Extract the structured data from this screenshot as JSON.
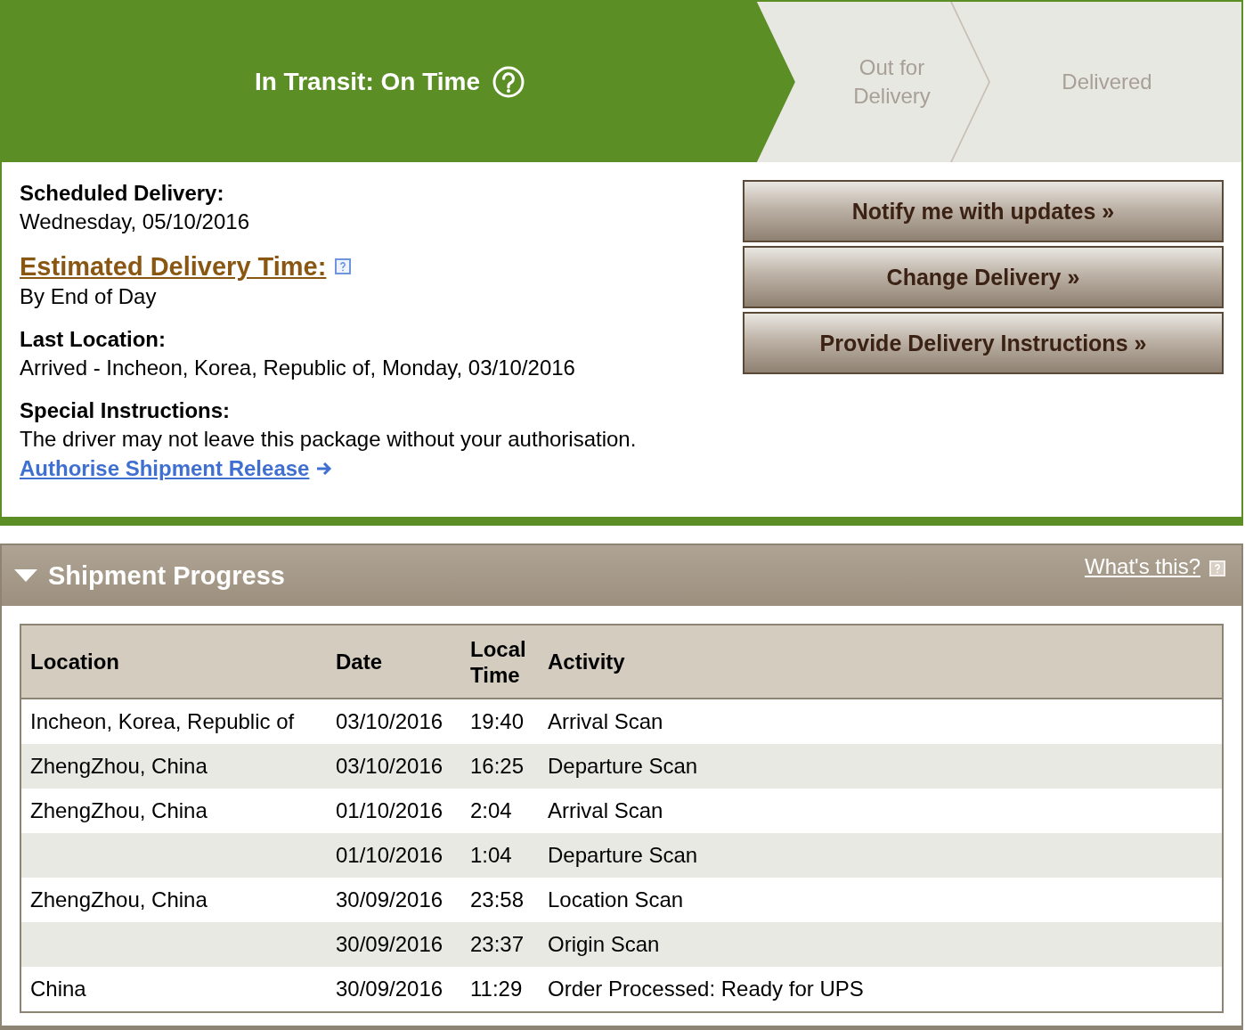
{
  "status_tracker": {
    "steps": [
      {
        "label": "In Transit: On Time",
        "current": true
      },
      {
        "label": "Out for Delivery",
        "current": false
      },
      {
        "label": "Delivered",
        "current": false
      }
    ]
  },
  "details": [
    {
      "kind": "plain",
      "label": "Scheduled Delivery:",
      "value": "Wednesday, 05/10/2016"
    },
    {
      "kind": "link",
      "label": "Estimated Delivery Time:",
      "value": "By End of Day"
    },
    {
      "kind": "plain",
      "label": "Last Location:",
      "value": "Arrived - Incheon, Korea, Republic of, Monday, 03/10/2016"
    },
    {
      "kind": "plain",
      "label": "Special Instructions:",
      "value": "The driver may not leave this package without your authorisation.",
      "link": "Authorise Shipment Release"
    }
  ],
  "actions": [
    "Notify me with updates »",
    "Change Delivery »",
    "Provide Delivery Instructions »"
  ],
  "shipment_progress": {
    "title": "Shipment Progress",
    "expanded": true,
    "help_link": "What's this?",
    "columns": [
      "Location",
      "Date",
      "Local Time",
      "Activity"
    ],
    "rows": [
      {
        "location": "Incheon, Korea, Republic of",
        "date": "03/10/2016",
        "time": "19:40",
        "activity": "Arrival Scan"
      },
      {
        "location": "ZhengZhou, China",
        "date": "03/10/2016",
        "time": "16:25",
        "activity": "Departure Scan"
      },
      {
        "location": "ZhengZhou, China",
        "date": "01/10/2016",
        "time": "2:04",
        "activity": "Arrival Scan"
      },
      {
        "date": "01/10/2016",
        "time": "1:04",
        "activity": "Departure Scan"
      },
      {
        "location": "ZhengZhou, China",
        "date": "30/09/2016",
        "time": "23:58",
        "activity": "Location Scan"
      },
      {
        "date": "30/09/2016",
        "time": "23:37",
        "activity": "Origin Scan"
      },
      {
        "location": "China",
        "date": "30/09/2016",
        "time": "11:29",
        "activity": "Order Processed: Ready for UPS"
      }
    ]
  }
}
